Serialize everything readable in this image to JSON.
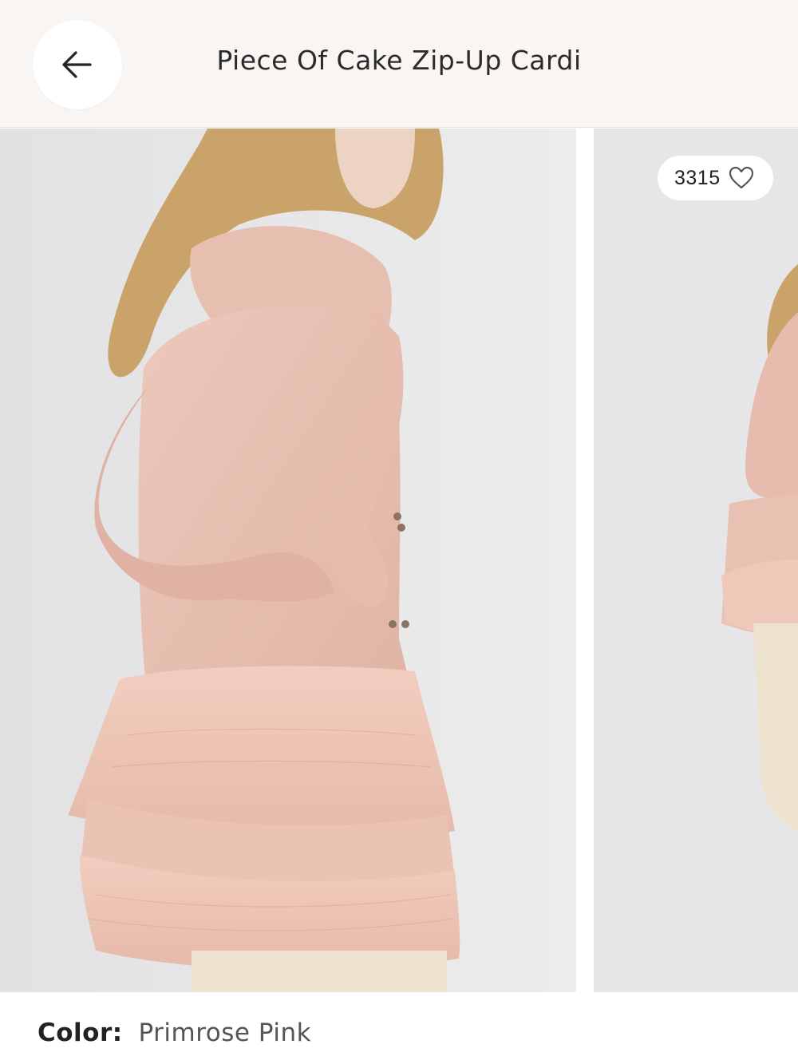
{
  "header": {
    "title": "Piece Of Cake Zip-Up Cardi",
    "back_icon": "arrow-left-icon"
  },
  "gallery": {
    "like_count": "3315",
    "like_icon": "heart-outline-icon"
  },
  "product": {
    "color_label": "Color:",
    "color_value": "Primrose Pink"
  },
  "colors": {
    "header_bg": "#f8f5f3",
    "garment_pink": "#e9c3b6",
    "photo_bg": "#e9e8ea"
  }
}
